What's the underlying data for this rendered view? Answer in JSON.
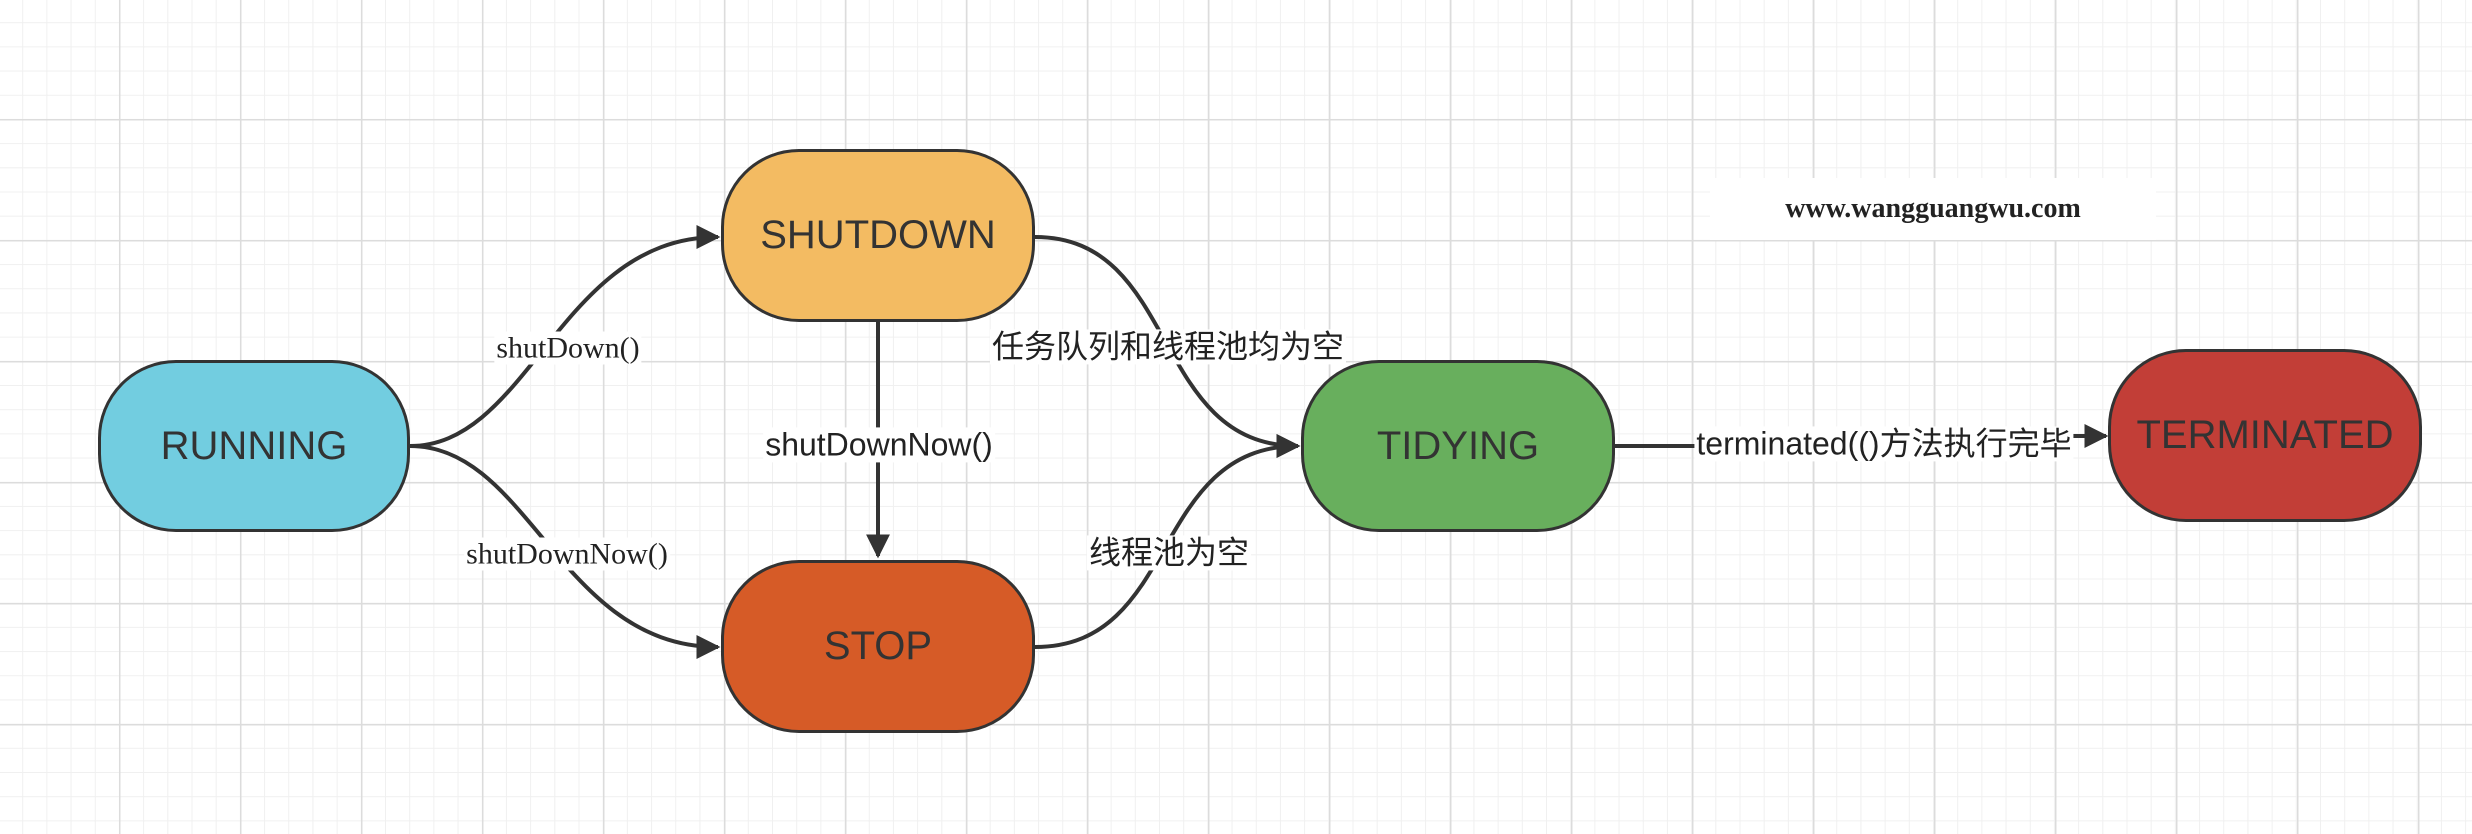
{
  "watermark": "www.wangguangwu.com",
  "nodes": {
    "running": {
      "label": "RUNNING",
      "color": "#72CDE0"
    },
    "shutdown": {
      "label": "SHUTDOWN",
      "color": "#F3BB62"
    },
    "stop": {
      "label": "STOP",
      "color": "#D65B27"
    },
    "tidying": {
      "label": "TIDYING",
      "color": "#68AF5D"
    },
    "terminated": {
      "label": "TERMINATED",
      "color": "#C23E37"
    }
  },
  "edges": {
    "running_to_shutdown": {
      "label": "shutDown()"
    },
    "running_to_stop": {
      "label": "shutDownNow()"
    },
    "shutdown_to_stop": {
      "label": "shutDownNow()"
    },
    "shutdown_to_tidying": {
      "label": "任务队列和线程池均为空"
    },
    "stop_to_tidying": {
      "label": "线程池为空"
    },
    "tidying_to_terminated": {
      "label": "terminated(()方法执行完毕"
    }
  },
  "stroke_color": "#333333"
}
